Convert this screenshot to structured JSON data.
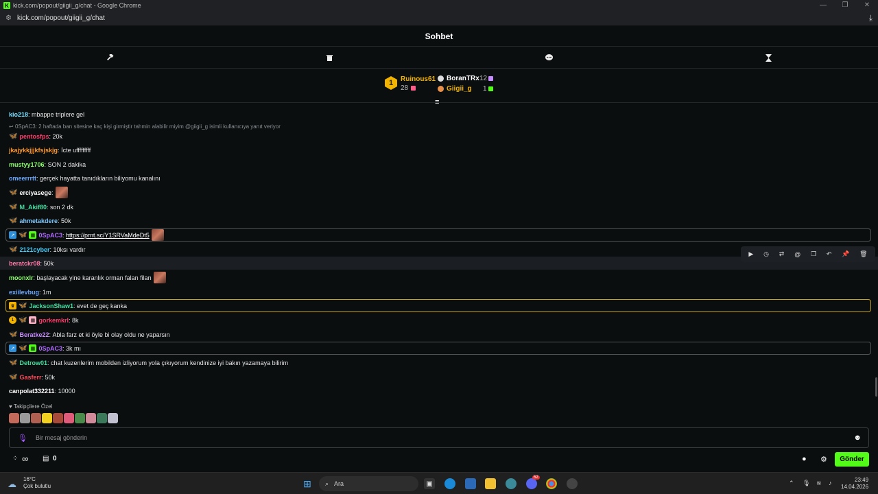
{
  "browser": {
    "window_title": "kick.com/popout/giigii_g/chat - Google Chrome",
    "url": "kick.com/popout/giigii_g/chat"
  },
  "header": {
    "title": "Sohbet"
  },
  "toolbar": {
    "icons": [
      "gavel-icon",
      "trash-icon",
      "chat-bubble-icon",
      "hourglass-icon"
    ]
  },
  "leaderboard": {
    "first": {
      "rank": "1",
      "name": "Ruinous61",
      "count": "28"
    },
    "second": {
      "name": "BoranTRx",
      "count": "12"
    },
    "third": {
      "name": "Giigii_g",
      "count": "1"
    }
  },
  "messages": [
    {
      "user": "kio218",
      "color": "#7be0ff",
      "text": "mbappe triplere gel"
    },
    {
      "reply": "0SpAC3: 2 haftada ban sitesine kaç kişi girmiştir tahmin alabilir miyim @giigii_g isimli kullanıcıya yanıt veriyor"
    },
    {
      "user": "pentosfps",
      "color": "#ff3b6b",
      "text": "20k"
    },
    {
      "user": "jkajykkjjjkfsjskjg",
      "color": "#ff9a2e",
      "text": "İcte ufffffffff"
    },
    {
      "user": "mustyy1706",
      "color": "#8bff6b",
      "text": "SON 2 dakika"
    },
    {
      "user": "omeerrrtt",
      "color": "#6ba8ff",
      "text": "gerçek hayatta tanıdıkların biliyomu kanalını"
    },
    {
      "user": "erciyasege",
      "color": "#ffffff",
      "text": ""
    },
    {
      "user": "M_Akif80",
      "color": "#3fe0a0",
      "text": "son 2 dk"
    },
    {
      "user": "ahmetakdere",
      "color": "#7bc8ff",
      "text": "50k"
    },
    {
      "user": "0SpAC3",
      "color": "#b06bff",
      "text": "",
      "link": "https://prnt.sc/Y1SRVaMdeDt5"
    },
    {
      "user": "2121cyber",
      "color": "#3fd0ff",
      "text": "10ksı vardır"
    },
    {
      "user": "beratckr08",
      "color": "#ff7aa8",
      "text": "50k"
    },
    {
      "user": "moonxlr",
      "color": "#8bff6b",
      "text": "başlayacak yine karanlık orman falan filan"
    },
    {
      "user": "exiilevbug",
      "color": "#6ba8ff",
      "text": "1m"
    },
    {
      "user": "JacksonShaw1",
      "color": "#3fe0a0",
      "text": "evet de geç kanka"
    },
    {
      "user": "gorkemkrl",
      "color": "#ff3b6b",
      "text": "8k"
    },
    {
      "user": "Beratke22",
      "color": "#c58bff",
      "text": "Abla farz et ki öyle bi olay oldu ne yaparsın"
    },
    {
      "user": "0SpAC3",
      "color": "#b06bff",
      "text": "3k mı"
    },
    {
      "user": "Detrow01",
      "color": "#3fe0a0",
      "text": "chat kuzenlerim mobilden izliyorum yola çıkıyorum kendinize iyi bakın yazamaya bilirim"
    },
    {
      "user": "Gasferr",
      "color": "#ff4a5a",
      "text": "50k"
    },
    {
      "user": "canpolat332211",
      "color": "#ffffff",
      "text": "10000"
    }
  ],
  "emotes_section": {
    "label": "Takipçilere Özel"
  },
  "input": {
    "placeholder": "Bir mesaj gönderin"
  },
  "bottom": {
    "infinity": "∞",
    "count": "0",
    "send_label": "Gönder"
  },
  "taskbar": {
    "weather_temp": "16°C",
    "weather_desc": "Çok bulutlu",
    "search_label": "Ara",
    "time": "23:49",
    "date": "14.04.2026",
    "discord_badge": "52"
  }
}
